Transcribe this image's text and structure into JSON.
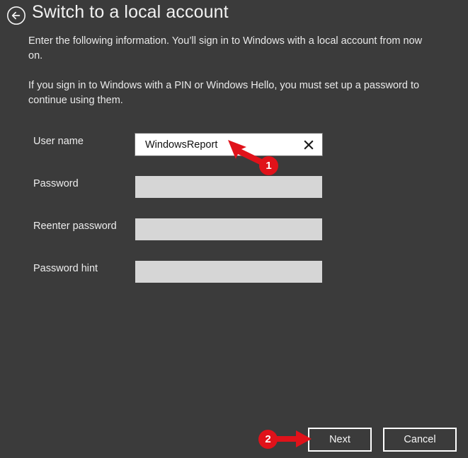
{
  "header": {
    "back_icon": "back-arrow-circle-icon",
    "title": "Switch to a local account"
  },
  "intro": {
    "paragraph_1": "Enter the following information. You’ll sign in to Windows with a local account from now on.",
    "paragraph_2": "If you sign in to Windows with a PIN or Windows Hello, you must set up a password to continue using them."
  },
  "form": {
    "fields": [
      {
        "label": "User name",
        "value": "WindowsReport",
        "placeholder": "",
        "state": "active",
        "clear_icon": "close-x-icon"
      },
      {
        "label": "Password",
        "value": "",
        "placeholder": "",
        "state": "inactive"
      },
      {
        "label": "Reenter password",
        "value": "",
        "placeholder": "",
        "state": "inactive"
      },
      {
        "label": "Password hint",
        "value": "",
        "placeholder": "",
        "state": "inactive"
      }
    ]
  },
  "footer": {
    "next_label": "Next",
    "cancel_label": "Cancel"
  },
  "annotations": {
    "marker_1": "1",
    "marker_2": "2",
    "color": "#e0121a"
  },
  "colors": {
    "background": "#3b3b3b",
    "field_inactive": "#d6d6d6",
    "field_active": "#ffffff",
    "text": "#f0f0f0",
    "accent": "#e0121a"
  }
}
